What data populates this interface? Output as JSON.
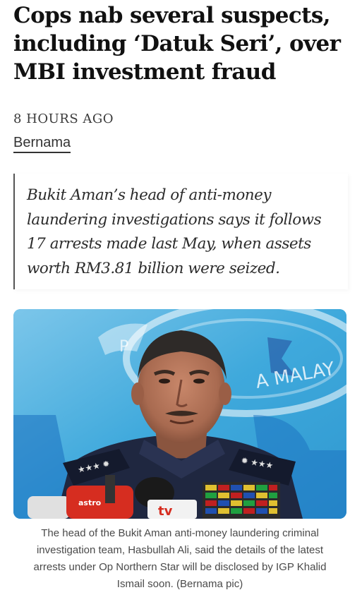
{
  "article": {
    "headline_lines": [
      "Cops nab several suspects,",
      "including ‘Datuk Seri’, over",
      "MBI investment fraud"
    ],
    "timestamp": "8 HOURS AGO",
    "source": "Bernama",
    "standfirst_lines": [
      "Bukit Aman’s head of anti-money",
      "laundering investigations says it follows",
      "17 arrests made last May, when assets",
      "worth RM3.81 billion were seized."
    ],
    "photo": {
      "backdrop_text": "A MALAY",
      "backdrop_emblem_text": "P",
      "mic_label": "tv"
    },
    "caption_lines": [
      "The head of the Bukit Aman anti-money laundering criminal",
      "investigation team, Hasbullah Ali, said the details of the latest",
      "arrests under Op Northern Star will be disclosed by IGP Khalid",
      "Ismail soon. (Bernama pic)"
    ]
  },
  "colors": {
    "headline": "#111111",
    "backdrop_blue": "#3fa9dc",
    "uniform_navy": "#1f2740",
    "mic_red": "#d62d20"
  }
}
